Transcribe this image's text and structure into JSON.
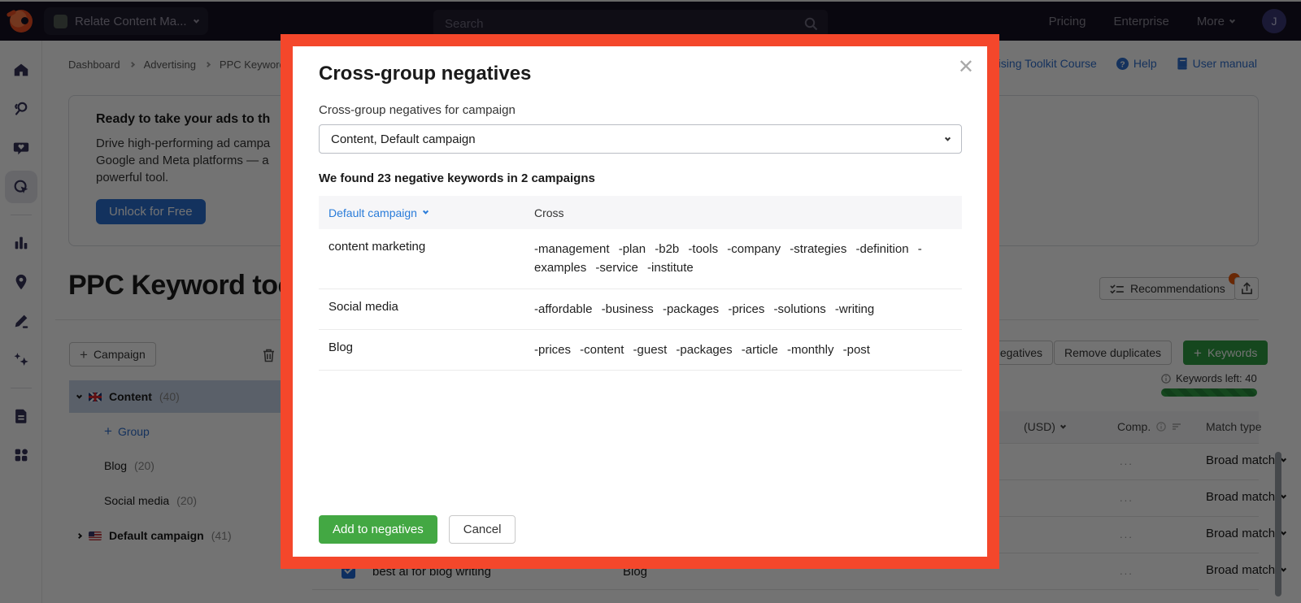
{
  "colors": {
    "accent_frame": "#f4472b",
    "green": "#43a843",
    "link_blue": "#2f6fce",
    "nav_bg": "#161122",
    "selected_row": "#c7d4e8"
  },
  "topbar": {
    "project_selector": "Relate Content Ma...",
    "search_placeholder": "Search",
    "links": {
      "pricing": "Pricing",
      "enterprise": "Enterprise",
      "more": "More"
    },
    "avatar_initial": "J"
  },
  "sidebar": {
    "icons": [
      "home-icon",
      "keyword-research-icon",
      "social-icon",
      "advertising-icon",
      "analytics-icon",
      "local-icon",
      "content-icon",
      "ai-trends-icon",
      "reports-icon",
      "apps-grid-icon"
    ],
    "active": "advertising-icon"
  },
  "breadcrumb": {
    "items": [
      "Dashboard",
      "Advertising",
      "PPC Keyword tool"
    ]
  },
  "header_links": {
    "course": "Advertising Toolkit Course",
    "help": "Help",
    "manual": "User manual"
  },
  "promo": {
    "title": "Ready to take your ads to th",
    "line1": "Drive high-performing ad campa",
    "line2": "Google and Meta platforms — a",
    "line3": "powerful tool.",
    "cta": "Unlock for Free"
  },
  "page": {
    "title": "PPC Keyword tool"
  },
  "panel": {
    "campaign_button": "Campaign",
    "tree": {
      "selected": {
        "label": "Content",
        "count": "(40)"
      },
      "add_group": "Group",
      "items": [
        {
          "label": "Blog",
          "count": "(20)"
        },
        {
          "label": "Social media",
          "count": "(20)"
        }
      ],
      "collapsed": {
        "label": "Default campaign",
        "count": "(41)"
      }
    }
  },
  "toolbar": {
    "recommendations": "Recommendations",
    "negatives_button": "Cross-group negatives",
    "remove_duplicates": "Remove duplicates",
    "add_keywords": "Keywords",
    "keywords_left": "Keywords left: 40"
  },
  "table": {
    "headers": {
      "cpc": "(USD)",
      "comp": "Comp.",
      "match": "Match type"
    },
    "comp_placeholder": "...",
    "match_label": "Broad match",
    "bottom_row": {
      "keyword": "best ai for blog writing",
      "group": "Blog"
    }
  },
  "modal": {
    "title": "Cross-group negatives",
    "label": "Cross-group negatives for campaign",
    "select_value": "Content, Default campaign",
    "found_text": "We found 23 negative keywords in 2 campaigns",
    "table": {
      "col1": "Default campaign",
      "col2": "Cross",
      "rows": [
        {
          "group": "content marketing",
          "negatives": "-management -plan -b2b -tools -company -strategies -definition -examples -service -institute"
        },
        {
          "group": "Social media",
          "negatives": "-affordable -business -packages -prices -solutions -writing"
        },
        {
          "group": "Blog",
          "negatives": "-prices -content -guest -packages -article -monthly -post"
        }
      ]
    },
    "add_button": "Add to negatives",
    "cancel_button": "Cancel"
  }
}
